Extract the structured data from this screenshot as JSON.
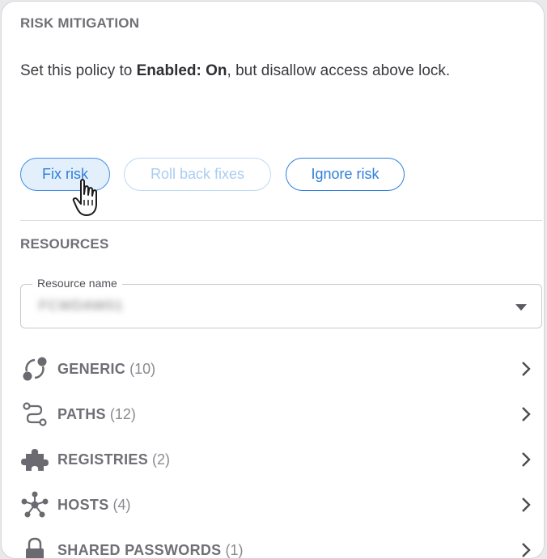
{
  "risk_mitigation": {
    "title": "RISK MITIGATION",
    "description_prefix": "Set this policy to ",
    "description_bold": "Enabled: On",
    "description_suffix": ", but disallow access above lock."
  },
  "actions": {
    "fix_risk": "Fix risk",
    "roll_back": "Roll back fixes",
    "ignore_risk": "Ignore risk"
  },
  "resources": {
    "title": "RESOURCES",
    "field_label": "Resource name",
    "field_value": "FCWDAW01",
    "items": [
      {
        "name": "GENERIC",
        "count": "(10)",
        "icon": "generic-icon"
      },
      {
        "name": "PATHS",
        "count": "(12)",
        "icon": "paths-icon"
      },
      {
        "name": "REGISTRIES",
        "count": "(2)",
        "icon": "puzzle-icon"
      },
      {
        "name": "HOSTS",
        "count": "(4)",
        "icon": "network-icon"
      },
      {
        "name": "SHARED PASSWORDS",
        "count": "(1)",
        "icon": "lock-icon"
      }
    ]
  },
  "colors": {
    "accent": "#2f7fdc",
    "accent_light": "#e3f0fc",
    "muted_text": "#6f6f76"
  }
}
